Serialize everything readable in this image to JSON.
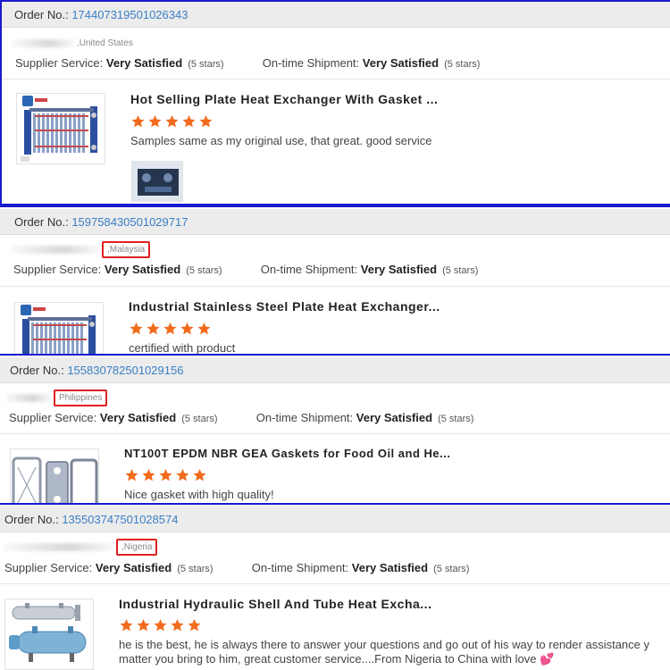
{
  "reviews": [
    {
      "order_label": "Order No.:",
      "order_number": "174407319501026343",
      "country": ",United States",
      "supplier_label": "Supplier Service:",
      "supplier_value": "Very Satisfied",
      "supplier_stars_text": "(5 stars)",
      "shipment_label": "On-time Shipment:",
      "shipment_value": "Very Satisfied",
      "shipment_stars_text": "(5 stars)",
      "product_title": "Hot Selling Plate Heat Exchanger With Gasket ...",
      "rating": 5,
      "comment": "Samples same as my original use, that great. good service"
    },
    {
      "order_label": "Order No.:",
      "order_number": "159758430501029717",
      "country": ",Malaysia",
      "supplier_label": "Supplier Service:",
      "supplier_value": "Very Satisfied",
      "supplier_stars_text": "(5 stars)",
      "shipment_label": "On-time Shipment:",
      "shipment_value": "Very Satisfied",
      "shipment_stars_text": "(5 stars)",
      "product_title": "Industrial Stainless Steel Plate Heat Exchanger...",
      "rating": 5,
      "comment": "certified with product"
    },
    {
      "order_label": "Order No.:",
      "order_number": "155830782501029156",
      "country": "Philippines",
      "supplier_label": "Supplier Service:",
      "supplier_value": "Very Satisfied",
      "supplier_stars_text": "(5 stars)",
      "shipment_label": "On-time Shipment:",
      "shipment_value": "Very Satisfied",
      "shipment_stars_text": "(5 stars)",
      "product_title": "NT100T EPDM NBR GEA Gaskets for Food Oil and He...",
      "rating": 5,
      "comment": "Nice gasket with high quality!"
    },
    {
      "order_label": "Order No.:",
      "order_number": "135503747501028574",
      "country": ",Nigeria",
      "supplier_label": "Supplier Service:",
      "supplier_value": "Very Satisfied",
      "supplier_stars_text": "(5 stars)",
      "shipment_label": "On-time Shipment:",
      "shipment_value": "Very Satisfied",
      "shipment_stars_text": "(5 stars)",
      "product_title": "Industrial Hydraulic Shell And Tube Heat Excha...",
      "rating": 5,
      "comment": "he is the best, he is always there to answer your questions and go out of his way to render assistance y matter you bring to him, great customer service....From Nigeria to China with love",
      "comment_emoji": "💕"
    }
  ],
  "colors": {
    "accent_link": "#3a7fc6",
    "star": "#f26b1d",
    "highlight_box": "#e02020",
    "section_border": "#1a1ad0"
  }
}
